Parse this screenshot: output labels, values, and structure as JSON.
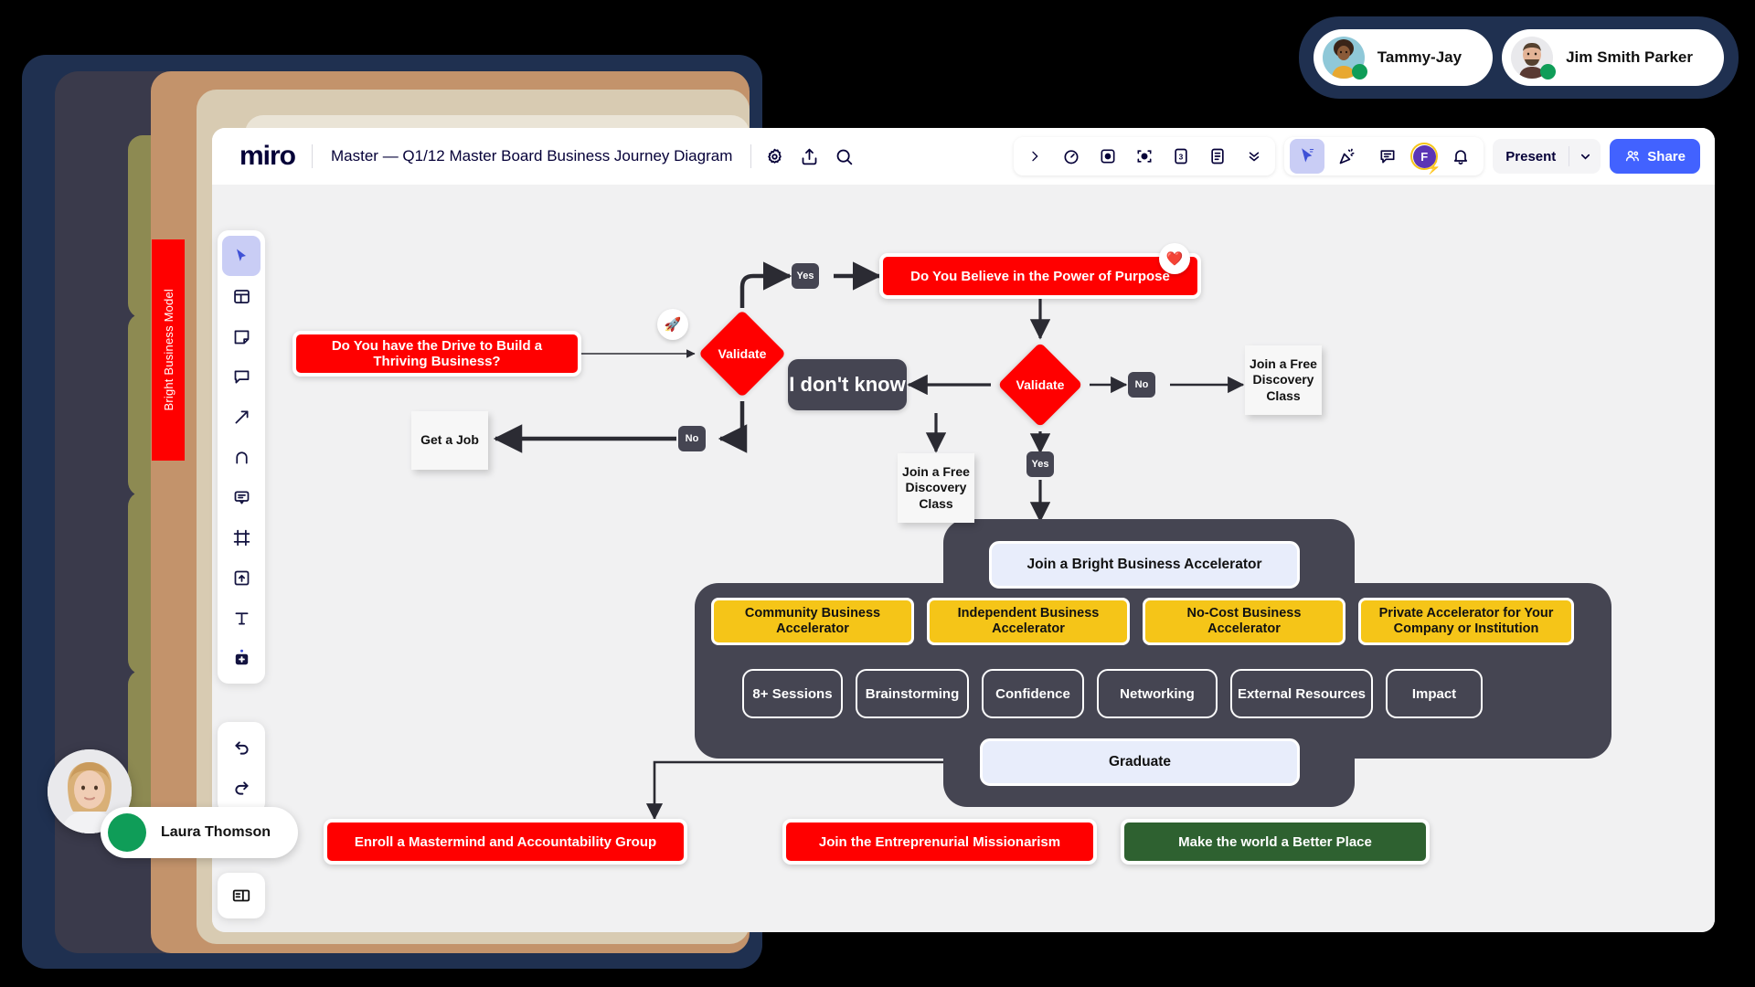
{
  "app": {
    "logo": "miro",
    "board_title": "Master — Q1/12 Master Board Business Journey Diagram",
    "header_icons": [
      {
        "name": "gear-icon",
        "label": "Settings"
      },
      {
        "name": "share-upload-icon",
        "label": "Export"
      },
      {
        "name": "search-icon",
        "label": "Search"
      }
    ],
    "toolbar_left_group": [
      {
        "name": "chevron-right-icon",
        "label": "Expand"
      },
      {
        "name": "timer-icon",
        "label": "Timer"
      },
      {
        "name": "video-chat-icon",
        "label": "Video chat"
      },
      {
        "name": "attention-icon",
        "label": "Bring to me"
      },
      {
        "name": "voting-icon",
        "label": "Voting"
      },
      {
        "name": "notes-icon",
        "label": "Notes"
      },
      {
        "name": "chevron-double-down-icon",
        "label": "More apps"
      }
    ],
    "toolbar_right_group": [
      {
        "name": "cursor-select-icon",
        "label": "Select",
        "active": true
      },
      {
        "name": "celebrate-icon",
        "label": "Reactions"
      },
      {
        "name": "comment-icon",
        "label": "Comments"
      }
    ],
    "favorite_avatar": {
      "initial": "F",
      "badge": "bolt",
      "ring_color": "#f5c518",
      "bg_color": "#5b35b5"
    },
    "bell_icon": "notifications-bell-icon",
    "present_label": "Present",
    "share_label": "Share",
    "share_color": "#4262ff"
  },
  "left_rail": {
    "tools": [
      {
        "name": "cursor-tool",
        "label": "Select",
        "active": true
      },
      {
        "name": "templates-tool",
        "label": "Templates",
        "active": false
      },
      {
        "name": "sticky-note-tool",
        "label": "Sticky note",
        "active": false
      },
      {
        "name": "comment-tool",
        "label": "Comment",
        "active": false
      },
      {
        "name": "arrow-tool",
        "label": "Connection line",
        "active": false
      },
      {
        "name": "pen-tool",
        "label": "Pen",
        "active": false
      },
      {
        "name": "text-comment-tool",
        "label": "Text box",
        "active": false
      },
      {
        "name": "frame-tool",
        "label": "Frame",
        "active": false
      },
      {
        "name": "upload-tool",
        "label": "Upload",
        "active": false
      },
      {
        "name": "text-tool",
        "label": "Text",
        "active": false
      },
      {
        "name": "more-apps-tool",
        "label": "More apps",
        "active": false
      }
    ],
    "history": [
      {
        "name": "undo-button",
        "label": "Undo"
      },
      {
        "name": "redo-button",
        "label": "Redo"
      }
    ],
    "panel_toggle": {
      "name": "panel-toggle-button",
      "label": "Toggle panel"
    }
  },
  "binder": {
    "red_tab_label": "Bright Business Model"
  },
  "collaborators": [
    {
      "name": "Tammy-Jay",
      "status": "online"
    },
    {
      "name": "Jim Smith Parker",
      "status": "online"
    }
  ],
  "current_user": {
    "name": "Laura Thomson",
    "status": "online"
  },
  "chart_data": {
    "type": "diagram",
    "title": "Business Journey Flowchart",
    "nodes": [
      {
        "id": "drive",
        "text": "Do You have the Drive to Build a Thriving Business?",
        "shape": "process",
        "color": "#FF0000",
        "badge": "rocket"
      },
      {
        "id": "validate1",
        "text": "Validate",
        "shape": "decision",
        "color": "#FF0000"
      },
      {
        "id": "getjob",
        "text": "Get a Job",
        "shape": "sticky",
        "color": "#f7f7f7"
      },
      {
        "id": "purpose",
        "text": "Do You Believe in the Power of Purpose",
        "shape": "process",
        "color": "#FF0000",
        "badge": "heart"
      },
      {
        "id": "validate2",
        "text": "Validate",
        "shape": "decision",
        "color": "#FF0000"
      },
      {
        "id": "dontknow",
        "text": "I don't know",
        "shape": "process",
        "color": "#454552"
      },
      {
        "id": "free1",
        "text": "Join a Free Discovery Class",
        "shape": "sticky",
        "color": "#f7f7f7"
      },
      {
        "id": "free2",
        "text": "Join a Free Discovery Class",
        "shape": "sticky",
        "color": "#f7f7f7"
      },
      {
        "id": "joinaccel",
        "text": "Join  a Bright Business Accelerator",
        "shape": "process",
        "color": "#e8edfb"
      },
      {
        "id": "graduate",
        "text": "Graduate",
        "shape": "process",
        "color": "#e8edfb"
      },
      {
        "id": "enroll",
        "text": "Enroll a Mastermind and Accountability Group",
        "shape": "process",
        "color": "#FF0000"
      },
      {
        "id": "missionary",
        "text": "Join the Entreprenurial Missionarism",
        "shape": "process",
        "color": "#FF0000"
      },
      {
        "id": "betterplace",
        "text": "Make the world a Better Place",
        "shape": "process",
        "color": "#2e6130"
      }
    ],
    "edge_labels": [
      "Yes",
      "No",
      "No",
      "Yes"
    ],
    "accelerators": [
      "Community Business Accelerator",
      "Independent Business Accelerator",
      "No-Cost Business Accelerator",
      "Private Accelerator for Your Company or Institution"
    ],
    "benefits": [
      "8+ Sessions",
      "Brainstorming",
      "Confidence",
      "Networking",
      "External Resources",
      "Impact"
    ],
    "palette": {
      "red": "#FF0000",
      "green": "#2e6130",
      "yellow": "#f5c518",
      "dark": "#454552",
      "lavender": "#e8edfb",
      "canvas": "#f1f1f2"
    }
  }
}
